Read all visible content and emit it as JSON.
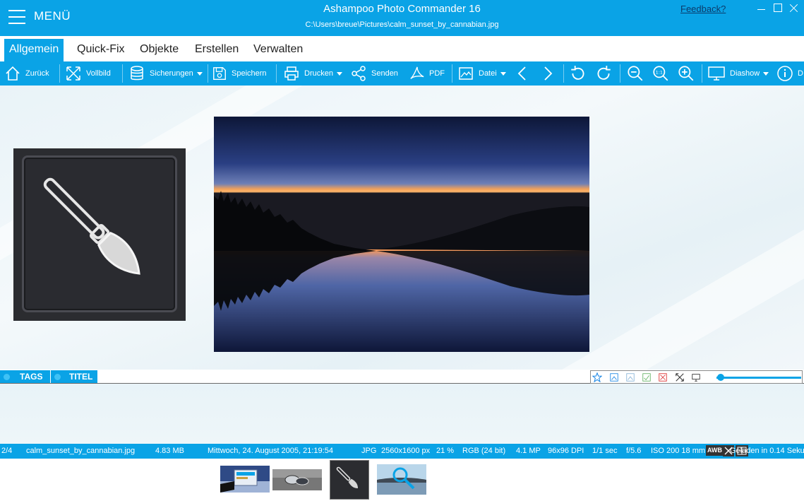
{
  "titlebar": {
    "menu_label": "MENÜ",
    "app_title": "Ashampoo Photo Commander 16",
    "file_path": "C:\\Users\\breue\\Pictures\\calm_sunset_by_cannabian.jpg",
    "feedback_label": "Feedback?"
  },
  "tabs": [
    {
      "label": "Allgemein",
      "active": true
    },
    {
      "label": "Quick-Fix"
    },
    {
      "label": "Objekte"
    },
    {
      "label": "Erstellen"
    },
    {
      "label": "Verwalten"
    }
  ],
  "toolbar": {
    "back": "Zurück",
    "fullscreen": "Vollbild",
    "backups": "Sicherungen",
    "save": "Speichern",
    "print": "Drucken",
    "send": "Senden",
    "pdf": "PDF",
    "file": "Datei",
    "slideshow": "Diashow",
    "info": "D"
  },
  "tagbar": {
    "tags_label": "TAGS",
    "title_label": "TITEL",
    "zoom_level": 0.05
  },
  "status": {
    "index": "2/4",
    "filename": "calm_sunset_by_cannabian.jpg",
    "filesize": "4.83 MB",
    "date": "Mittwoch, 24. August 2005, 21:19:54",
    "format": "JPG",
    "dimensions": "2560x1600 px",
    "zoom": "21 %",
    "color": "RGB (24 bit)",
    "megapixels": "4.1 MP",
    "dpi": "96x96 DPI",
    "exposure": "1/1 sec",
    "aperture": "f/5.6",
    "iso_focal": "ISO 200 18 mm",
    "awb": "AWB",
    "loaded": "Geladen in 0.14 Seku"
  },
  "colors": {
    "accent": "#0aa3e6",
    "titlebar_text": "#ffffff"
  }
}
